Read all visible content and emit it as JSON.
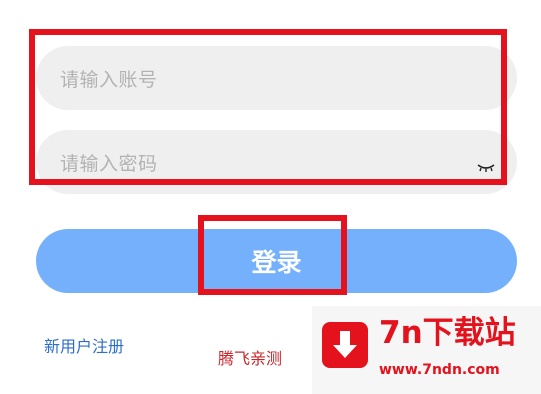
{
  "login_form": {
    "account_placeholder": "请输入账号",
    "password_placeholder": "请输入密码",
    "login_button_label": "登录",
    "register_link_label": "新用户注册",
    "eye_icon": "eye-closed-icon"
  },
  "watermark": {
    "text": "腾飞亲测"
  },
  "logo": {
    "title": "7n下载站",
    "url": "www.7ndn.com",
    "icon": "download-arrow-icon",
    "brand_color": "#e3121c"
  },
  "colors": {
    "login_button": "#74b0fb",
    "input_background": "#efefef",
    "annotation": "#e3121c",
    "register_link": "#2d6ec9"
  }
}
